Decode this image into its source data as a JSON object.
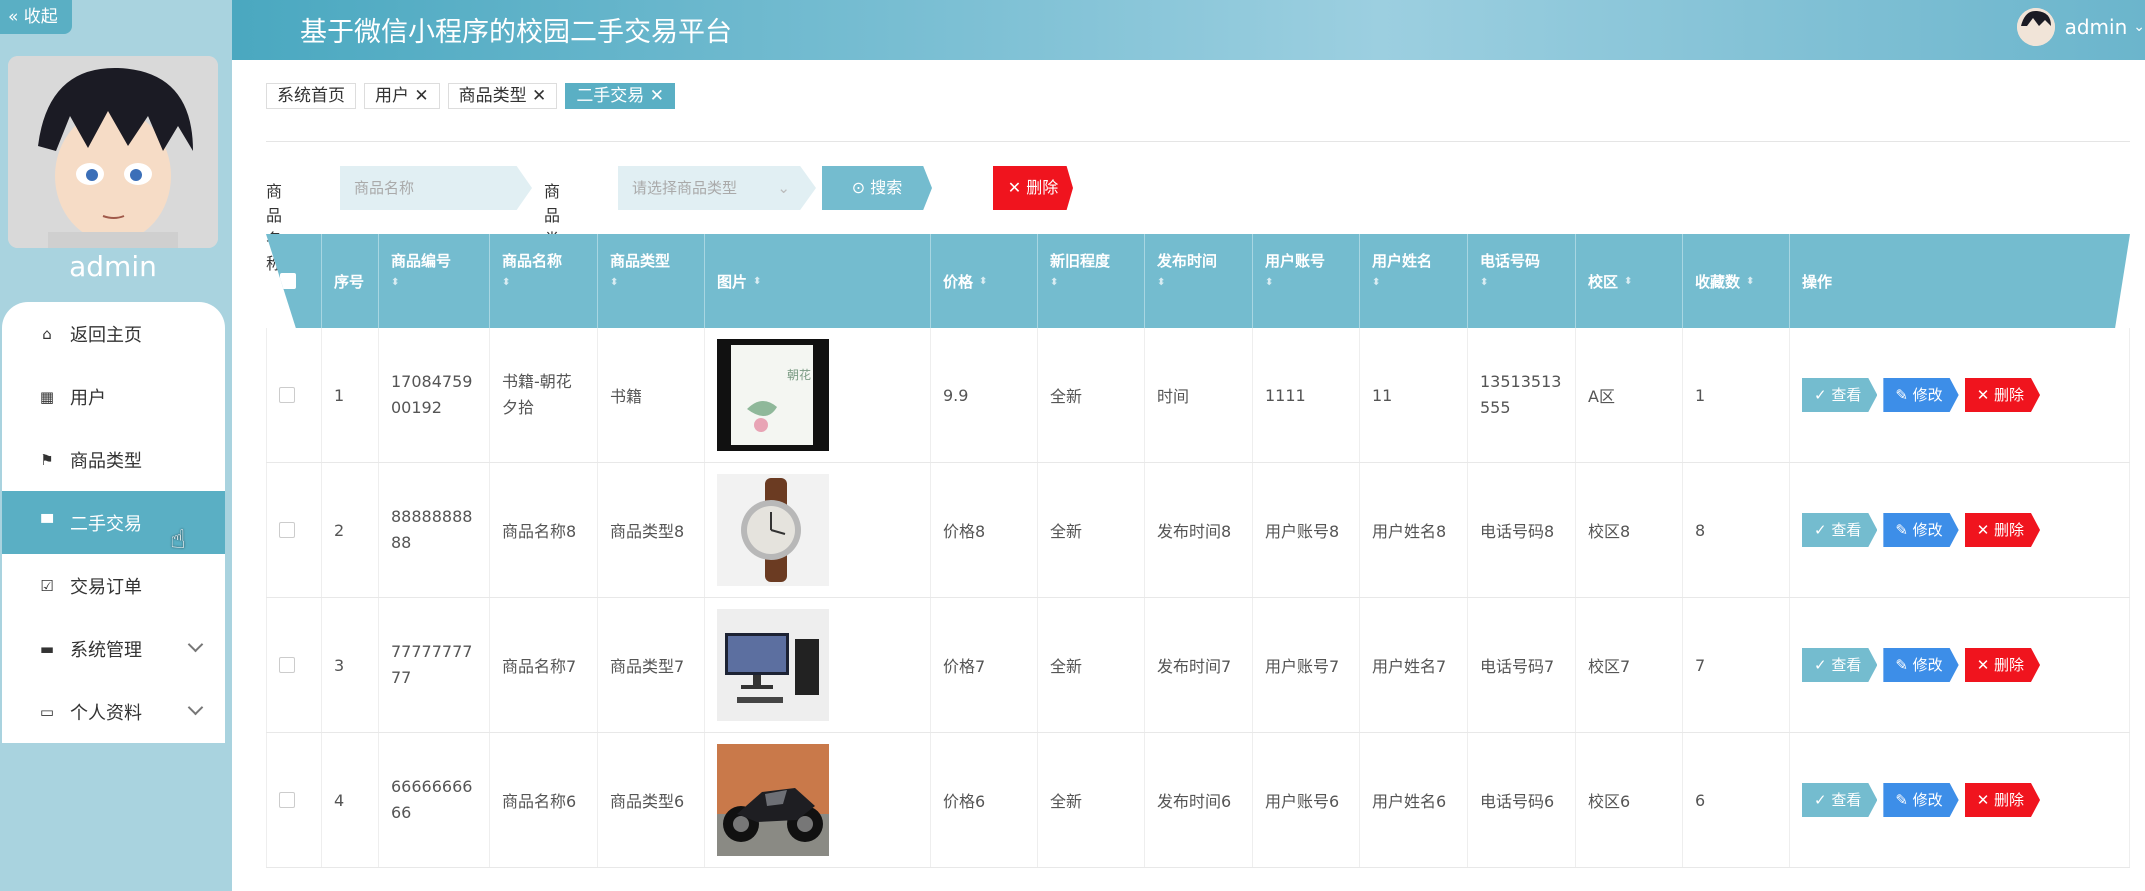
{
  "app": {
    "title": "基于微信小程序的校园二手交易平台",
    "user": "admin",
    "collapse_label": "« 收起"
  },
  "sidebar": {
    "username": "admin",
    "items": [
      {
        "label": "返回主页",
        "icon": "home-icon"
      },
      {
        "label": "用户",
        "icon": "grid-icon"
      },
      {
        "label": "商品类型",
        "icon": "flag-icon"
      },
      {
        "label": "二手交易",
        "icon": "sign-icon",
        "active": true
      },
      {
        "label": "交易订单",
        "icon": "clipboard-icon"
      },
      {
        "label": "系统管理",
        "icon": "briefcase-icon",
        "expandable": true
      },
      {
        "label": "个人资料",
        "icon": "card-icon",
        "expandable": true
      }
    ]
  },
  "tags": [
    {
      "label": "系统首页"
    },
    {
      "label": "用户 ✕"
    },
    {
      "label": "商品类型 ✕"
    },
    {
      "label": "二手交易 ✕",
      "active": true
    }
  ],
  "search": {
    "name_label": "商品名称",
    "name_placeholder": "商品名称",
    "type_label": "商品类型",
    "type_placeholder": "请选择商品类型",
    "search_button": "⊙ 搜索",
    "delete_button": "✕ 删除"
  },
  "table": {
    "headers": [
      "序号",
      "商品编号",
      "商品名称",
      "商品类型",
      "图片",
      "价格",
      "新旧程度",
      "发布时间",
      "用户账号",
      "用户姓名",
      "电话号码",
      "校区",
      "收藏数",
      "操作"
    ],
    "sort_glyph": "⬍",
    "op_labels": {
      "view": "✓ 查看",
      "edit": "✎ 修改",
      "delete": "✕ 删除"
    },
    "rows": [
      {
        "no": "1",
        "code": "1708475900192",
        "name": "书籍-朝花夕拾",
        "type": "书籍",
        "image": "book",
        "price": "9.9",
        "condition": "全新",
        "time": "时间",
        "account": "1111",
        "realname": "11",
        "phone": "13513513555",
        "campus": "A区",
        "fav": "1"
      },
      {
        "no": "2",
        "code": "8888888888",
        "name": "商品名称8",
        "type": "商品类型8",
        "image": "watch",
        "price": "价格8",
        "condition": "全新",
        "time": "发布时间8",
        "account": "用户账号8",
        "realname": "用户姓名8",
        "phone": "电话号码8",
        "campus": "校区8",
        "fav": "8"
      },
      {
        "no": "3",
        "code": "7777777777",
        "name": "商品名称7",
        "type": "商品类型7",
        "image": "computer",
        "price": "价格7",
        "condition": "全新",
        "time": "发布时间7",
        "account": "用户账号7",
        "realname": "用户姓名7",
        "phone": "电话号码7",
        "campus": "校区7",
        "fav": "7"
      },
      {
        "no": "4",
        "code": "6666666666",
        "name": "商品名称6",
        "type": "商品类型6",
        "image": "motorcycle",
        "price": "价格6",
        "condition": "全新",
        "time": "发布时间6",
        "account": "用户账号6",
        "realname": "用户姓名6",
        "phone": "电话号码6",
        "campus": "校区6",
        "fav": "6"
      }
    ]
  },
  "colors": {
    "accent": "#5aafc4",
    "header_th": "#74bccf",
    "edit": "#3d8ee8",
    "danger": "#f0141e"
  }
}
